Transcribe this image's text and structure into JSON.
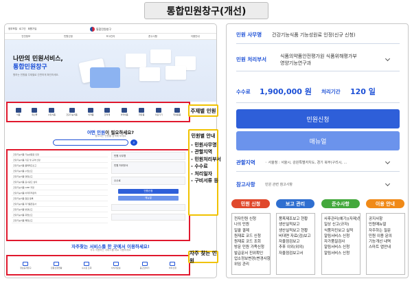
{
  "title": "통합민원창구(개선)",
  "left": {
    "top_links": [
      "정부포털",
      "로그인",
      "회원가입"
    ],
    "logo_text": "통합민원창구",
    "nav": [
      "안전정보",
      "민원신청",
      "보고관리",
      "준수사항",
      "이용안내"
    ],
    "hero_line1": "나만의 민원서비스,",
    "hero_line2": "통합민원창구",
    "hero_sub": "원하는 민원을 주제별로 간편하게 확인하세요.",
    "icon_items": [
      "식품",
      "축산물",
      "수입식품",
      "건강기능식품",
      "의약품",
      "한약재",
      "의약외품",
      "화장품",
      "의료기기",
      "위생용품"
    ],
    "callout_theme": "주제별 민원",
    "question_pre": "어떤 민원",
    "question_post": "이 필요하세요?",
    "question_sub": "찾으시는 민원을 검색해 보세요",
    "table_rows": [
      "건강기능식품 기능성원료 인정",
      "건강기능식품 기준 및 규격 인정",
      "건강기능식품 품목제조신고",
      "건강기능식품 수입신고",
      "건강기능식품 영업신고",
      "건강기능식품 표시광고 심의",
      "건강기능식품 GMP 지정",
      "건강기능식품 이력추적관리",
      "건강기능식품 원료 등록",
      "건강기능식품 자가품질검사",
      "건강기능식품 변경신고",
      "건강기능식품 휴업신고",
      "건강기능식품 폐업신고"
    ],
    "detail_rows": [
      "민원 사무명",
      "민원 처리부서",
      "수수료",
      "처리기간"
    ],
    "detail_buttons": [
      "민원신청",
      "매뉴얼"
    ],
    "callout_list_title": "민원별 안내",
    "callout_list": [
      "- 민원사무명",
      "- 관할지역",
      "- 민원처리부서",
      "- 수수료",
      "- 처리일자",
      "- 구비서류 등"
    ],
    "freq_pre": "자주찾는 서비스를 한 곳에서 이용하세요!",
    "freq_sub": "자주 이용하는 서비스를 바로 이용하세요",
    "freq_items": [
      "정보공개청구",
      "민원신청현황",
      "수수료 조회",
      "서식자료실",
      "묻고답하기",
      "이의신청"
    ],
    "callout_freq": "자주 찾는 민원"
  },
  "right": {
    "name_label": "민원 사무명",
    "name_value": "건강기능식품 기능성원료 인정(신규 신청)",
    "dept_label": "민원 처리부서",
    "dept_value_1": "식품의약품안전평가원 식품위해평가부",
    "dept_value_2": "영양기능연구과",
    "fee_label": "수수료",
    "fee_value": "1,900,000 원",
    "period_label": "처리기간",
    "period_value": "120 일",
    "apply_button": "민원신청",
    "manual_button": "매뉴얼",
    "region_label": "관할지역",
    "region_value": "◦ 서울청 : 서울시, 강원특별자치도, 경기 북부(구리시, ...",
    "ref_label": "참고사항",
    "ref_value": "민원 관련 참고사항",
    "categories": [
      {
        "name": "민원 신청",
        "color": "#e0482c",
        "items": [
          "전자민원 신청",
          "나의 민원",
          "일괄 결제",
          "원재료 코드 신청",
          "원재료 코드 조회",
          "방문 민원 가족신청",
          "발급문서 진위확인",
          "업소정보변경(변경사항)",
          "위임 관리"
        ]
      },
      {
        "name": "보고 관리",
        "color": "#2f6fd0",
        "items": [
          "품목제조보고 현황",
          "생산실적보고",
          "생산실적보고 현황",
          "비대면 자료(검)보고",
          "자율점검보고",
          "추후 이외(위외)",
          "자율점검보고서"
        ]
      },
      {
        "name": "준수사항",
        "color": "#43a83c",
        "items": [
          "사후관리(예기)(자제)등",
          "일상 신고(규자)",
          "식품자진보고 실적",
          "알림서비스 신청",
          "자가품질검사",
          "알림서비스 신청",
          "알림서비스 신청"
        ]
      },
      {
        "name": "이용 안내",
        "color": "#f08a18",
        "items": [
          "공지사항",
          "민원매뉴얼",
          "자주하는 질문",
          "민원 이용 문의",
          "기능개선 내역",
          "스마트 앱안내"
        ]
      }
    ]
  }
}
